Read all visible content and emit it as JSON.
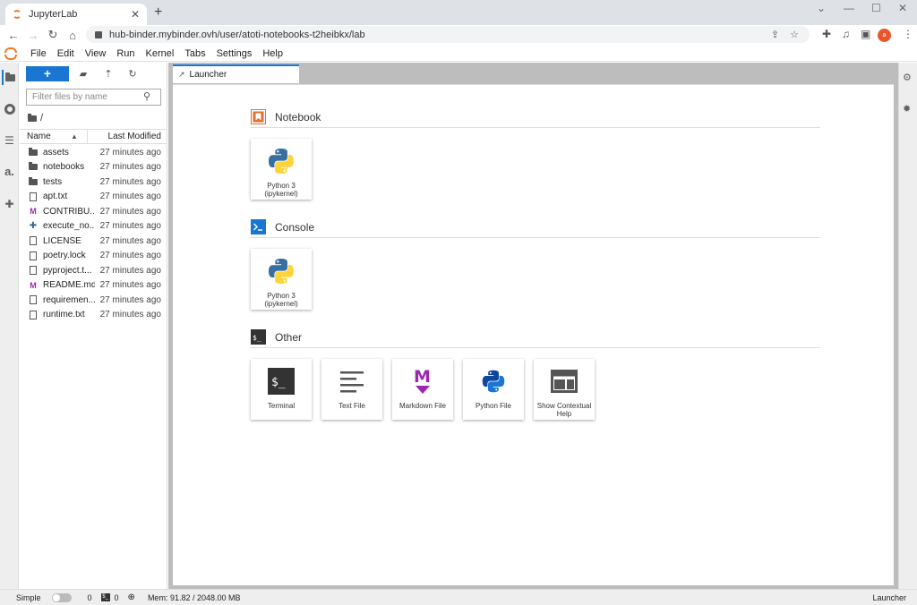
{
  "browser": {
    "tab_title": "JupyterLab",
    "url": "hub-binder.mybinder.ovh/user/atoti-notebooks-t2heibkx/lab",
    "avatar_initials": "a"
  },
  "menubar": {
    "items": [
      "File",
      "Edit",
      "View",
      "Run",
      "Kernel",
      "Tabs",
      "Settings",
      "Help"
    ]
  },
  "filebrowser": {
    "new_label": "+",
    "filter_placeholder": "Filter files by name",
    "breadcrumb": "/",
    "col_name": "Name",
    "col_modified": "Last Modified",
    "files": [
      {
        "name": "assets",
        "type": "folder",
        "modified": "27 minutes ago"
      },
      {
        "name": "notebooks",
        "type": "folder",
        "modified": "27 minutes ago"
      },
      {
        "name": "tests",
        "type": "folder",
        "modified": "27 minutes ago"
      },
      {
        "name": "apt.txt",
        "type": "file",
        "modified": "27 minutes ago"
      },
      {
        "name": "CONTRIBU...",
        "type": "markdown",
        "modified": "27 minutes ago"
      },
      {
        "name": "execute_no...",
        "type": "python",
        "modified": "27 minutes ago"
      },
      {
        "name": "LICENSE",
        "type": "file",
        "modified": "27 minutes ago"
      },
      {
        "name": "poetry.lock",
        "type": "file",
        "modified": "27 minutes ago"
      },
      {
        "name": "pyproject.t...",
        "type": "file",
        "modified": "27 minutes ago"
      },
      {
        "name": "README.md",
        "type": "markdown",
        "modified": "27 minutes ago"
      },
      {
        "name": "requiremen...",
        "type": "file",
        "modified": "27 minutes ago"
      },
      {
        "name": "runtime.txt",
        "type": "file",
        "modified": "27 minutes ago"
      }
    ]
  },
  "main": {
    "tab_label": "Launcher",
    "sections": {
      "notebook": {
        "title": "Notebook",
        "cards": [
          {
            "label": "Python 3 (ipykernel)"
          }
        ]
      },
      "console": {
        "title": "Console",
        "cards": [
          {
            "label": "Python 3 (ipykernel)"
          }
        ]
      },
      "other": {
        "title": "Other",
        "cards": [
          {
            "label": "Terminal"
          },
          {
            "label": "Text File"
          },
          {
            "label": "Markdown File"
          },
          {
            "label": "Python File"
          },
          {
            "label": "Show Contextual Help"
          }
        ]
      }
    }
  },
  "statusbar": {
    "simple_label": "Simple",
    "kernels_count": "0",
    "terminals_count": "0",
    "memory": "Mem: 91.82 / 2048.00 MB",
    "right_label": "Launcher"
  },
  "colors": {
    "accent": "#1976d2",
    "jupyter_orange": "#f37726",
    "markdown_purple": "#9c27b0",
    "python_blue": "#306998",
    "python_yellow": "#ffd43b"
  }
}
